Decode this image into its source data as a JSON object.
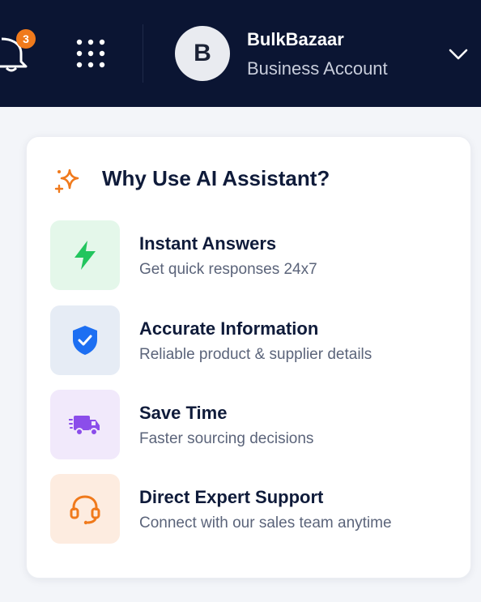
{
  "header": {
    "notification_count": "3",
    "avatar_initial": "B",
    "account_name": "BulkBazaar",
    "account_type": "Business Account",
    "background_color": "#0b1533"
  },
  "panel": {
    "title": "Why Use AI Assistant?",
    "accent_color": "#f07a1c",
    "features": [
      {
        "title": "Instant Answers",
        "description": "Get quick responses 24x7",
        "icon": "lightning-icon",
        "color": "#22c55e"
      },
      {
        "title": "Accurate Information",
        "description": "Reliable product & supplier details",
        "icon": "shield-check-icon",
        "color": "#1d6ff2"
      },
      {
        "title": "Save Time",
        "description": "Faster sourcing decisions",
        "icon": "delivery-truck-icon",
        "color": "#8b4dea"
      },
      {
        "title": "Direct Expert Support",
        "description": "Connect with our sales team anytime",
        "icon": "headset-icon",
        "color": "#f07a1c"
      }
    ]
  }
}
